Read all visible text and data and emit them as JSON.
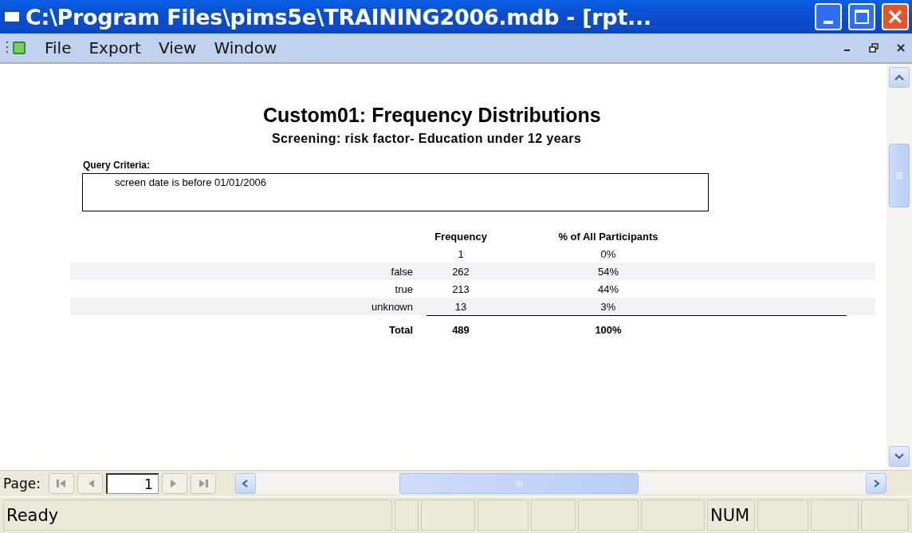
{
  "window": {
    "title": "C:\\Program Files\\pims5e\\TRAINING2006.mdb - [rpt..."
  },
  "menu": [
    {
      "label": "File"
    },
    {
      "label": "Export"
    },
    {
      "label": "View"
    },
    {
      "label": "Window"
    }
  ],
  "report": {
    "title": "Custom01: Frequency Distributions",
    "subtitle": "Screening: risk factor- Education under 12 years",
    "criteria_label": "Query Criteria:",
    "criteria": "screen date is before 01/01/2006",
    "columns": [
      "Frequency",
      "% of All Participants"
    ],
    "rows": [
      {
        "label": "",
        "frequency": "1",
        "percent": "0%",
        "shaded": false
      },
      {
        "label": "false",
        "frequency": "262",
        "percent": "54%",
        "shaded": true
      },
      {
        "label": "true",
        "frequency": "213",
        "percent": "44%",
        "shaded": false
      },
      {
        "label": "unknown",
        "frequency": "13",
        "percent": "3%",
        "shaded": true
      }
    ],
    "total": {
      "label": "Total",
      "frequency": "489",
      "percent": "100%"
    }
  },
  "navigation": {
    "label": "Page:",
    "page": "1"
  },
  "status_bar": {
    "message": "Ready",
    "indicators": [
      {
        "label": "NUM"
      }
    ]
  }
}
